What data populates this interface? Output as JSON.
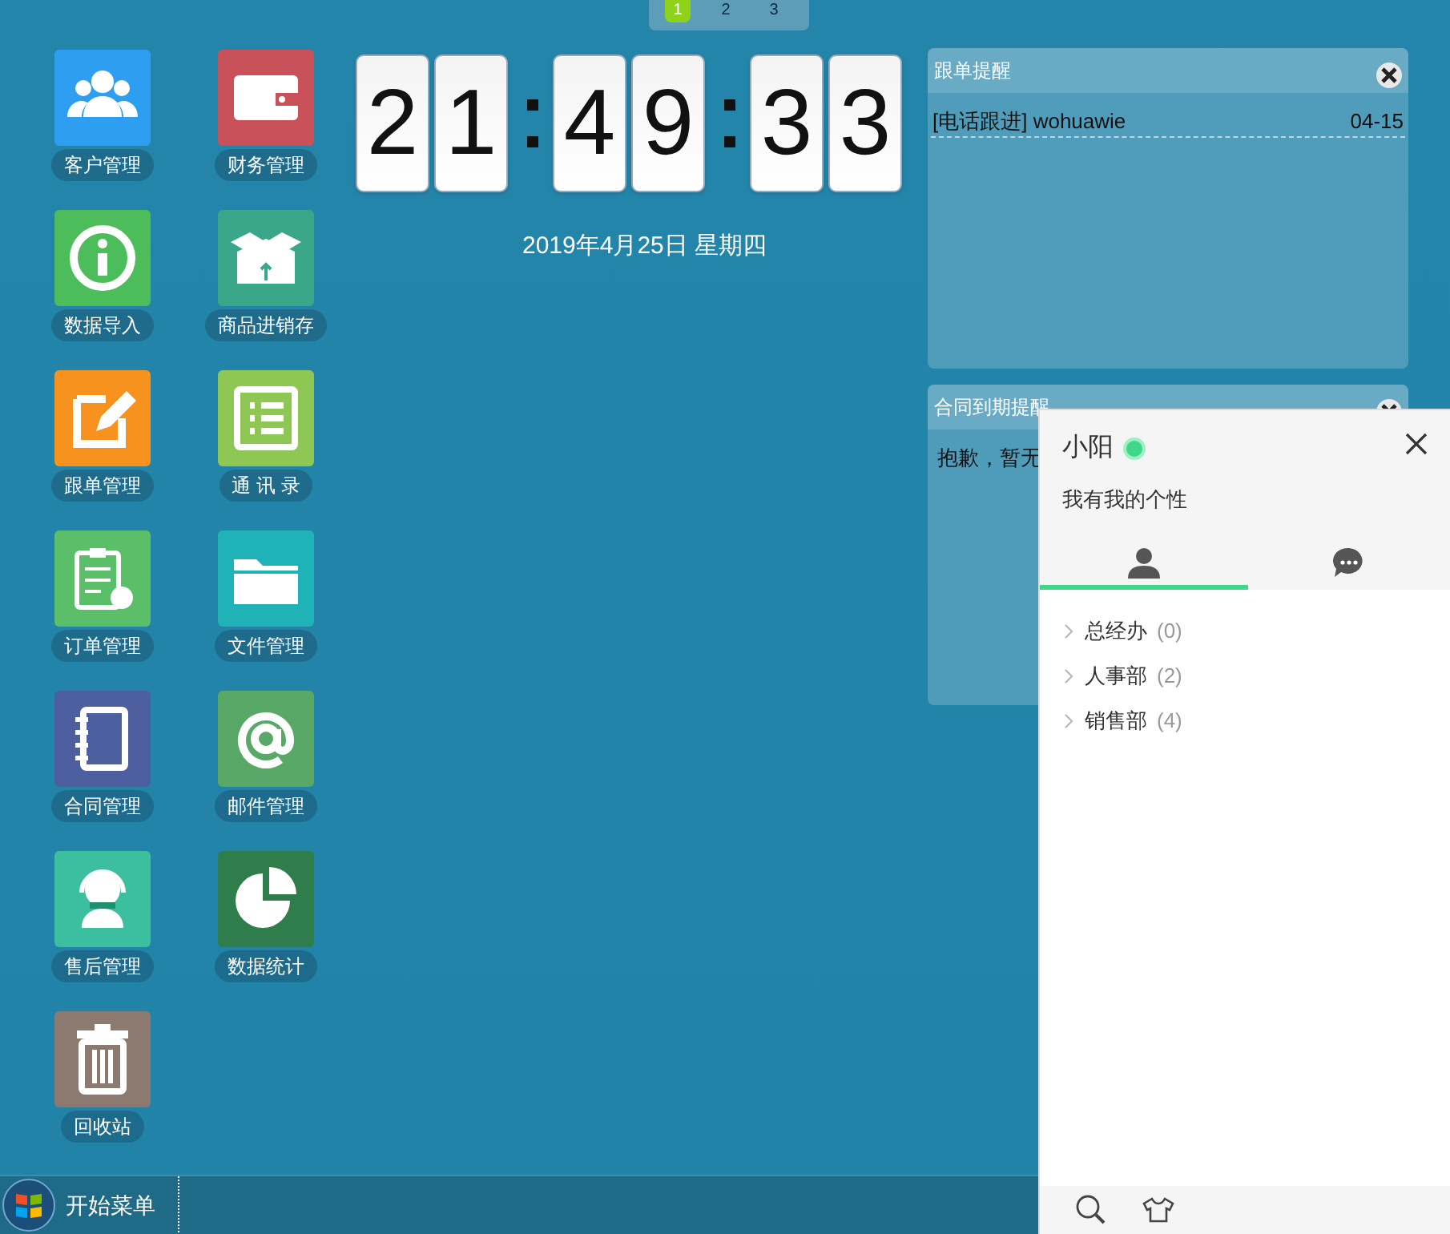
{
  "pager": [
    {
      "label": "1",
      "selected": true
    },
    {
      "label": "2",
      "selected": false
    },
    {
      "label": "3",
      "selected": false
    }
  ],
  "desktop_icons": [
    {
      "label": "客户管理",
      "color": "#2e9ff0"
    },
    {
      "label": "数据导入",
      "color": "#4cbd5a"
    },
    {
      "label": "跟单管理",
      "color": "#f7921e"
    },
    {
      "label": "订单管理",
      "color": "#5bbf6a"
    },
    {
      "label": "合同管理",
      "color": "#4e5f9f"
    },
    {
      "label": "售后管理",
      "color": "#3bbf9f"
    },
    {
      "label": "回收站",
      "color": "#8c7a70"
    },
    {
      "label": "财务管理",
      "color": "#c9525a"
    },
    {
      "label": "商品进销存",
      "color": "#3aa68a"
    },
    {
      "label": "通 讯 录",
      "color": "#8fc755"
    },
    {
      "label": "文件管理",
      "color": "#1fb3b8"
    },
    {
      "label": "邮件管理",
      "color": "#5aa868"
    },
    {
      "label": "数据统计",
      "color": "#2e7d4a"
    }
  ],
  "clock": {
    "digits": [
      "2",
      "1",
      "4",
      "9",
      "3",
      "3"
    ],
    "date": "2019年4月25日 星期四"
  },
  "widgets": [
    {
      "title": "跟单提醒",
      "rows": [
        {
          "text": "[电话跟进] wohuawie",
          "date": "04-15"
        }
      ]
    },
    {
      "title": "合同到期提醒",
      "message": "抱歉，暂无"
    }
  ],
  "chat_panel": {
    "name": "小阳",
    "online": true,
    "signature": "我有我的个性",
    "tabs": [
      {
        "kind": "contacts",
        "selected": true
      },
      {
        "kind": "messages",
        "selected": false
      }
    ],
    "groups": [
      {
        "name": "总经办",
        "count": "(0)",
        "expanded": false
      },
      {
        "name": "人事部",
        "count": "(2)",
        "expanded": false
      },
      {
        "name": "销售部",
        "count": "(4)",
        "expanded": false
      }
    ]
  },
  "taskbar": {
    "start_label": "开始菜单"
  }
}
